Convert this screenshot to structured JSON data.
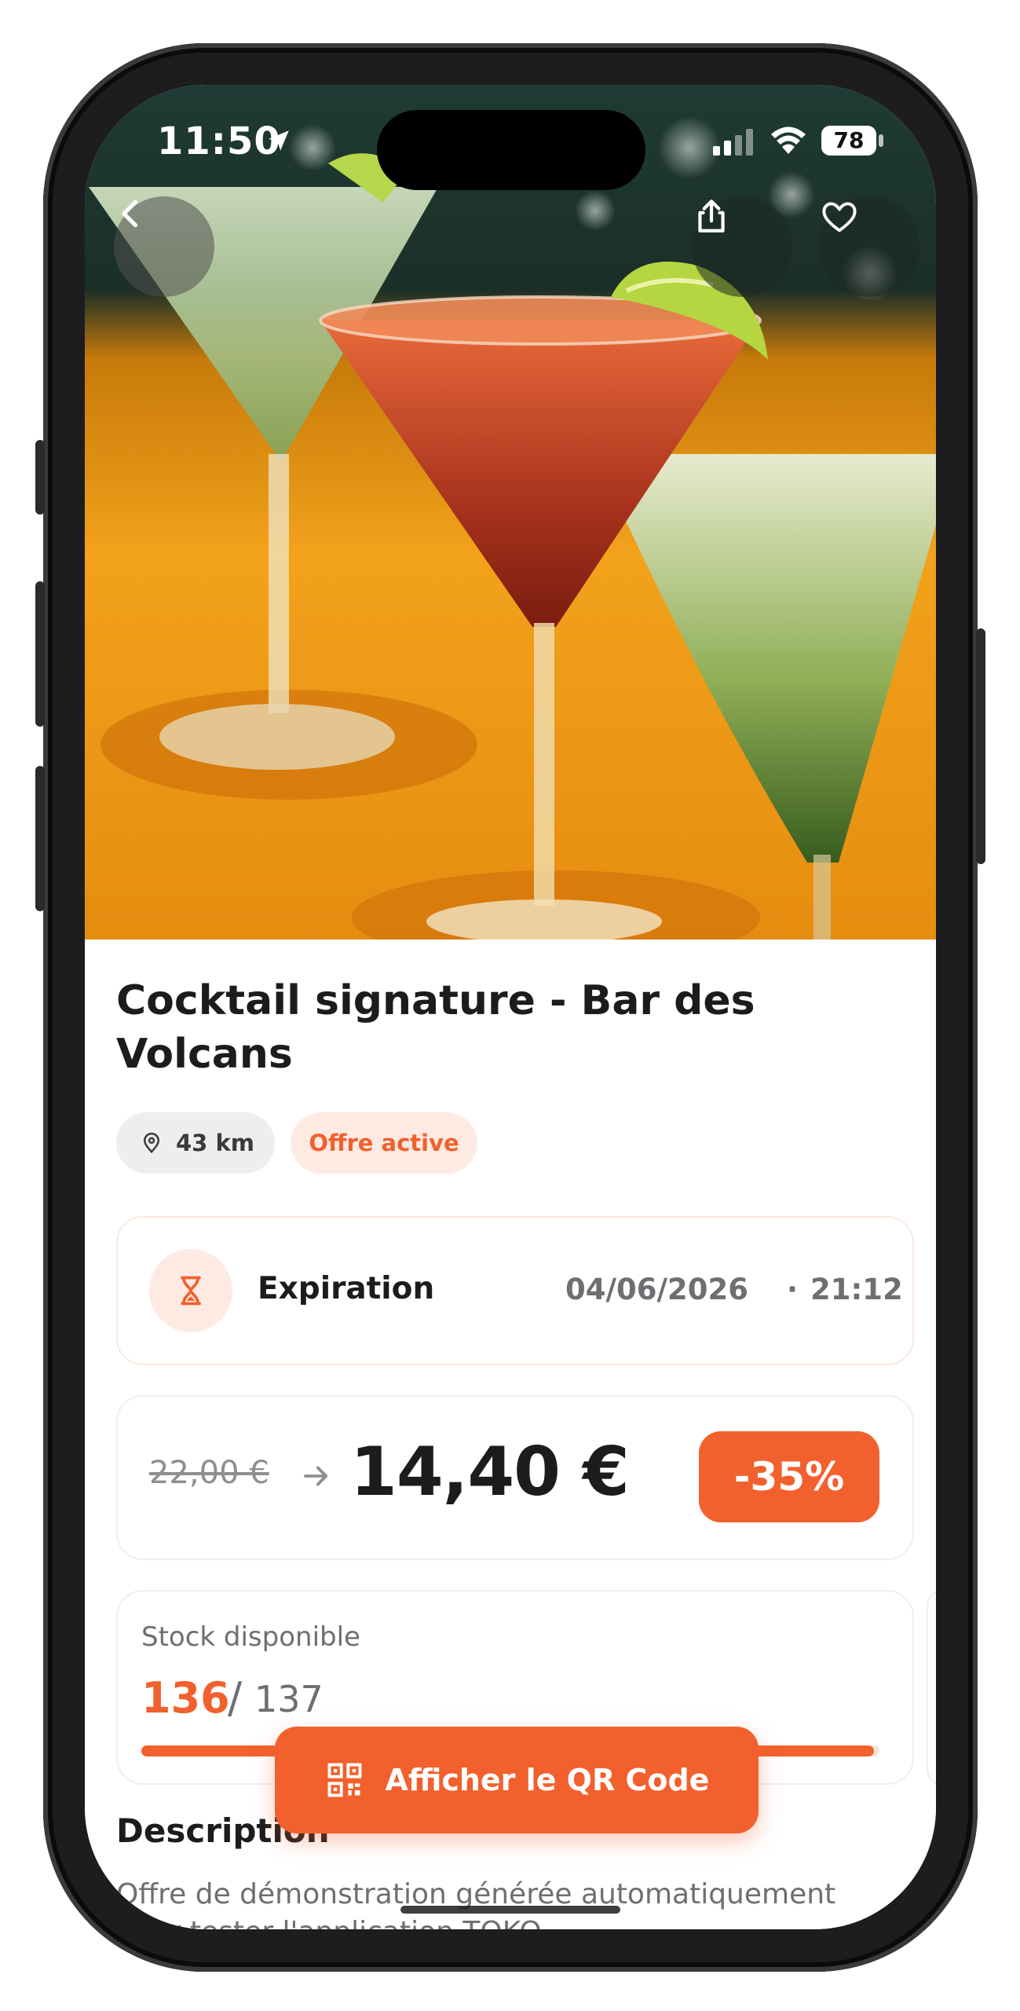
{
  "status_bar": {
    "time": "11:50",
    "battery": "78"
  },
  "offer": {
    "title": "Cocktail signature - Bar des Volcans",
    "distance": "43 km",
    "status_badge": "Offre active"
  },
  "expiration": {
    "label": "Expiration",
    "date": "04/06/2026",
    "separator": "·",
    "time": "21:12"
  },
  "price": {
    "old": "22,00 €",
    "new": "14,40 €",
    "discount": "-35%"
  },
  "stock": {
    "label": "Stock disponible",
    "available": "136",
    "separator": "/",
    "total": "137",
    "fill_fraction": 0.993
  },
  "qr_button": {
    "label": "Afficher le QR Code"
  },
  "description": {
    "heading": "Description",
    "text": "Offre de démonstration générée automatiquement pour tester l'application TOKO."
  },
  "colors": {
    "accent": "#f2602d",
    "accent_light": "#fdebe3",
    "chip_gray": "#eeeeef",
    "text_dark": "#1c1c1e",
    "text_muted": "#6e6e73"
  },
  "icons": [
    "back-chevron-icon",
    "share-icon",
    "heart-icon",
    "location-pin-icon",
    "hourglass-icon",
    "arrow-right-icon",
    "qr-code-icon"
  ]
}
